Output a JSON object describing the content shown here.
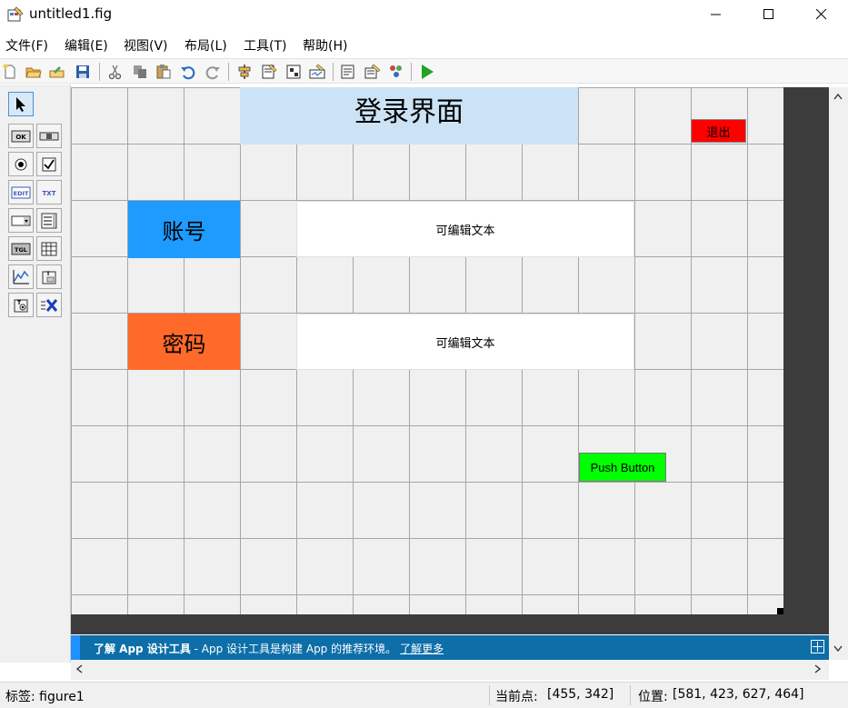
{
  "window": {
    "title": "untitled1.fig"
  },
  "menu": {
    "items": [
      "文件(F)",
      "编辑(E)",
      "视图(V)",
      "布局(L)",
      "工具(T)",
      "帮助(H)"
    ]
  },
  "toolbar": {
    "icons": [
      "new-file-icon",
      "open-folder-icon",
      "open-icon",
      "save-icon",
      "cut-icon",
      "copy-icon",
      "paste-icon",
      "undo-icon",
      "redo-icon",
      "align-icon",
      "menu-editor-icon",
      "tab-order-icon",
      "toolbar-editor-icon",
      "editor-icon",
      "property-inspector-icon",
      "object-browser-icon",
      "run-icon"
    ]
  },
  "canvas": {
    "title_panel": "登录界面",
    "exit_button": "退出",
    "account_label": "账号",
    "password_label": "密码",
    "edit_text_1": "可编辑文本",
    "edit_text_2": "可编辑文本",
    "push_button": "Push Button"
  },
  "colors": {
    "title_panel_bg": "#cce3f5",
    "exit_button_bg": "#ff0000",
    "account_label_bg": "#1e9bff",
    "password_label_bg": "#ff6a2b",
    "push_button_bg": "#00ff00",
    "banner_bg": "#0d6ea8"
  },
  "banner": {
    "bold": "了解 App 设计工具",
    "text": " - App 设计工具是构建 App 的推荐环境。",
    "link": "了解更多"
  },
  "status": {
    "tag": "标签: figure1",
    "current_point_label": "当前点:",
    "current_point_value": "[455, 342]",
    "position_label": "位置:",
    "position_value": "[581, 423, 627, 464]"
  }
}
